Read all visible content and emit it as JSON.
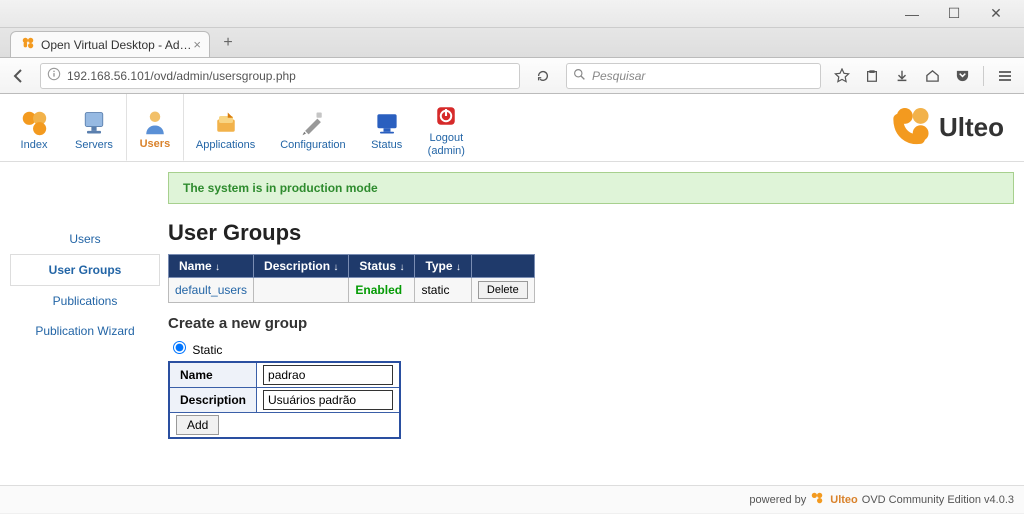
{
  "window": {
    "tab_title": "Open Virtual Desktop - Ad…",
    "tab_close": "×",
    "tab_add": "+"
  },
  "nav": {
    "url": "192.168.56.101/ovd/admin/usersgroup.php",
    "search_placeholder": "Pesquisar"
  },
  "toolbar": {
    "index": "Index",
    "servers": "Servers",
    "users": "Users",
    "applications": "Applications",
    "configuration": "Configuration",
    "status": "Status",
    "logout": "Logout\n(admin)"
  },
  "brand": {
    "name": "Ulteo"
  },
  "notice": {
    "text": "The system is in production mode"
  },
  "leftnav": {
    "users": "Users",
    "usergroups": "User Groups",
    "publications": "Publications",
    "wizard": "Publication Wizard"
  },
  "main": {
    "title": "User Groups",
    "table": {
      "headers": {
        "name": "Name",
        "description": "Description",
        "status": "Status",
        "type": "Type"
      },
      "rows": [
        {
          "name": "default_users",
          "description": "",
          "status": "Enabled",
          "type": "static",
          "delete": "Delete"
        }
      ]
    },
    "create": {
      "title": "Create a new group",
      "static_label": "Static",
      "name_label": "Name",
      "name_value": "padrao",
      "desc_label": "Description",
      "desc_value": "Usuários padrão",
      "add_label": "Add"
    }
  },
  "footer": {
    "prefix": "powered by",
    "brand": "Ulteo",
    "suffix": "OVD Community Edition v4.0.3"
  }
}
